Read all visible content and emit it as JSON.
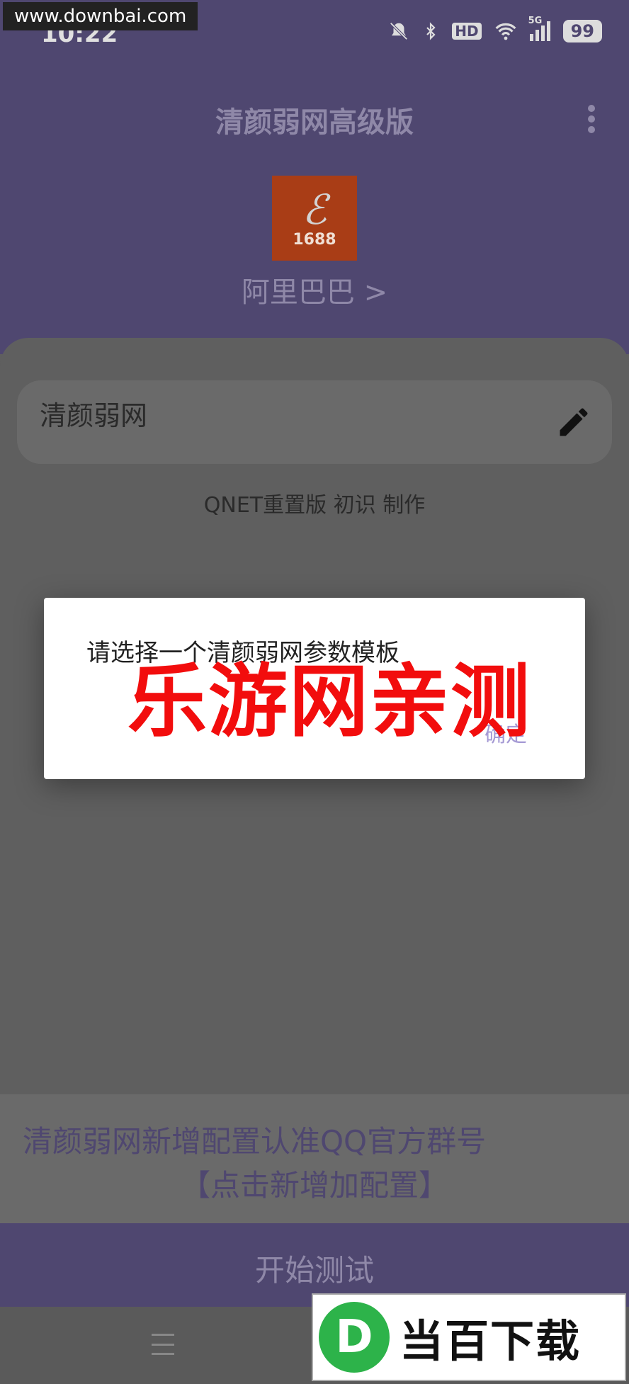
{
  "watermark_site": "www.downbai.com",
  "status_bar": {
    "time": "10:22",
    "hd_label": "HD",
    "network_label": "5G",
    "battery": "99"
  },
  "header": {
    "title": "清颜弱网高级版",
    "app_icon_number": "1688",
    "app_name": "阿里巴巴 >"
  },
  "card": {
    "name": "清颜弱网"
  },
  "credit": "QNET重置版 初识 制作",
  "dialog": {
    "message": "请选择一个清颜弱网参数模板",
    "confirm_label": "确定"
  },
  "watermark_text": "乐游网亲测",
  "banner": {
    "line1": "清颜弱网新增配置认准QQ官方群号",
    "line2": "【点击新增加配置】"
  },
  "start_button_label": "开始测试",
  "overlay_logo": {
    "letter": "D",
    "text": "当百下载"
  },
  "colors": {
    "header_bg": "#4f4770",
    "accent_text": "#8f88a8",
    "dialog_confirm": "#a59ad4",
    "watermark_red": "#f20d0d"
  }
}
